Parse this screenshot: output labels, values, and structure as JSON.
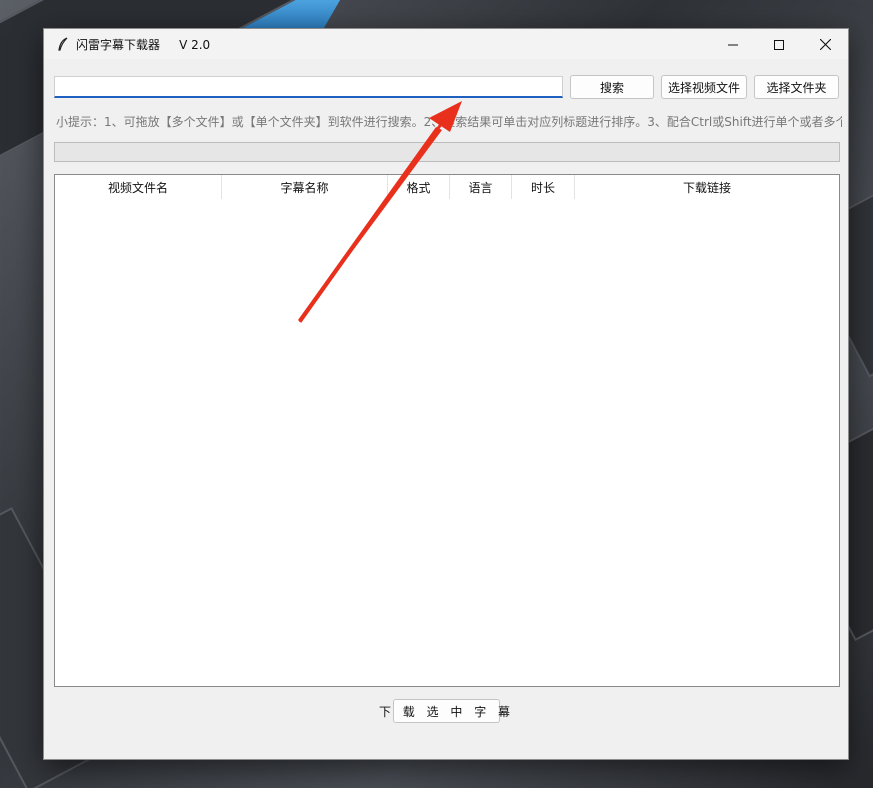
{
  "window": {
    "title": "闪雷字幕下载器     V 2.0",
    "minimize_icon": "minimize-icon",
    "maximize_icon": "maximize-icon",
    "close_icon": "close-icon"
  },
  "toolbar": {
    "search_value": "",
    "search_button": "搜索",
    "select_video_button": "选择视频文件",
    "select_folder_button": "选择文件夹"
  },
  "tip": "小提示：1、可拖放【多个文件】或【单个文件夹】到软件进行搜索。2、搜索结果可单击对应列标题进行排序。3、配合Ctrl或Shift进行单个或者多个",
  "progress": {
    "value": 0
  },
  "table": {
    "columns": [
      "视频文件名",
      "字幕名称",
      "格式",
      "语言",
      "时长",
      "下载链接"
    ],
    "rows": []
  },
  "footer": {
    "download_button": "下 载 选 中 字 幕"
  },
  "colors": {
    "accent": "#1f5fbf",
    "annotation_arrow": "#e8301c"
  }
}
